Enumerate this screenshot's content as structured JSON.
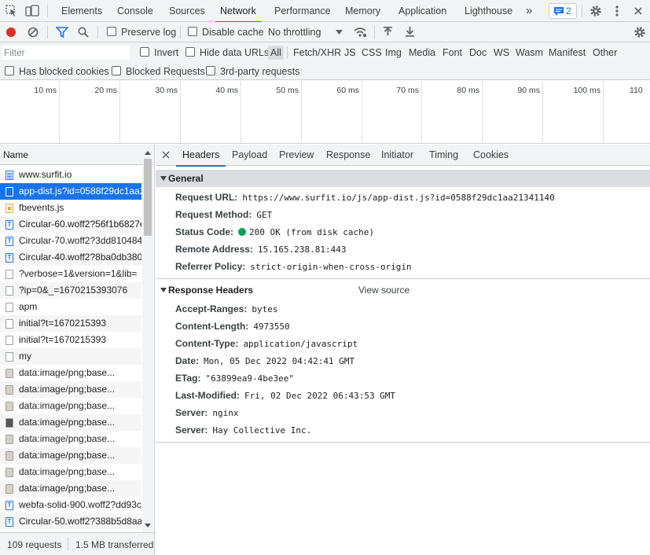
{
  "tabs": [
    "Elements",
    "Console",
    "Sources",
    "Network",
    "Performance",
    "Memory",
    "Application",
    "Lighthouse"
  ],
  "tabs_more": "»",
  "issues_count": "2",
  "toolbar": {
    "preserve_log": "Preserve log",
    "disable_cache": "Disable cache",
    "throttling": "No throttling"
  },
  "filter": {
    "placeholder": "Filter",
    "invert": "Invert",
    "hide_data_urls": "Hide data URLs",
    "types": [
      "All",
      "Fetch/XHR",
      "JS",
      "CSS",
      "Img",
      "Media",
      "Font",
      "Doc",
      "WS",
      "Wasm",
      "Manifest",
      "Other"
    ],
    "has_blocked_cookies": "Has blocked cookies",
    "blocked_requests": "Blocked Requests",
    "third_party": "3rd-party requests"
  },
  "timeline": {
    "ticks": [
      "10 ms",
      "20 ms",
      "30 ms",
      "40 ms",
      "50 ms",
      "60 ms",
      "70 ms",
      "80 ms",
      "90 ms",
      "100 ms",
      "110"
    ]
  },
  "list": {
    "header": "Name",
    "rows": [
      {
        "name": "www.surfit.io",
        "icon": "doc"
      },
      {
        "name": "app-dist.js?id=0588f29dc1aa2",
        "icon": "js"
      },
      {
        "name": "fbevents.js",
        "icon": "js"
      },
      {
        "name": "Circular-60.woff2?56f1b6827e",
        "icon": "font"
      },
      {
        "name": "Circular-70.woff2?3dd810484",
        "icon": "font"
      },
      {
        "name": "Circular-40.woff2?8ba0db380",
        "icon": "font"
      },
      {
        "name": "?verbose=1&version=1&lib=",
        "icon": "blank"
      },
      {
        "name": "?ip=0&_=1670215393076",
        "icon": "blank"
      },
      {
        "name": "apm",
        "icon": "blank"
      },
      {
        "name": "initial?t=1670215393",
        "icon": "blank"
      },
      {
        "name": "initial?t=1670215393",
        "icon": "blank"
      },
      {
        "name": "my",
        "icon": "blank"
      },
      {
        "name": "data:image/png;base...",
        "icon": "img"
      },
      {
        "name": "data:image/png;base...",
        "icon": "img"
      },
      {
        "name": "data:image/png;base...",
        "icon": "img"
      },
      {
        "name": "data:image/png;base...",
        "icon": "img2"
      },
      {
        "name": "data:image/png;base...",
        "icon": "img"
      },
      {
        "name": "data:image/png;base...",
        "icon": "img"
      },
      {
        "name": "data:image/png;base...",
        "icon": "img"
      },
      {
        "name": "data:image/png;base...",
        "icon": "img"
      },
      {
        "name": "webfa-solid-900.woff2?dd93c",
        "icon": "font"
      },
      {
        "name": "Circular-50.woff2?388b5d8aa",
        "icon": "font"
      }
    ],
    "selected_index": 1
  },
  "status": {
    "requests": "109 requests",
    "transferred": "1.5 MB transferred"
  },
  "detail_tabs": [
    "Headers",
    "Payload",
    "Preview",
    "Response",
    "Initiator",
    "Timing",
    "Cookies"
  ],
  "general": {
    "title": "General",
    "rows": [
      {
        "name": "Request URL:",
        "value": "https://www.surfit.io/js/app-dist.js?id=0588f29dc1aa21341140"
      },
      {
        "name": "Request Method:",
        "value": "GET"
      },
      {
        "name": "Status Code:",
        "value": "200 OK (from disk cache)"
      },
      {
        "name": "Remote Address:",
        "value": "15.165.238.81:443"
      },
      {
        "name": "Referrer Policy:",
        "value": "strict-origin-when-cross-origin"
      }
    ]
  },
  "response_headers": {
    "title": "Response Headers",
    "view_source": "View source",
    "rows": [
      {
        "name": "Accept-Ranges:",
        "value": "bytes"
      },
      {
        "name": "Content-Length:",
        "value": "4973550"
      },
      {
        "name": "Content-Type:",
        "value": "application/javascript"
      },
      {
        "name": "Date:",
        "value": "Mon, 05 Dec 2022 04:42:41 GMT"
      },
      {
        "name": "ETag:",
        "value": "\"63899ea9-4be3ee\""
      },
      {
        "name": "Last-Modified:",
        "value": "Fri, 02 Dec 2022 06:43:53 GMT"
      },
      {
        "name": "Server:",
        "value": "nginx"
      },
      {
        "name": "Server:",
        "value": "Hay Collective Inc."
      }
    ]
  },
  "colors": {
    "accent": "#1a73e8",
    "record": "#d93025",
    "status_ok": "#0d9d58"
  }
}
